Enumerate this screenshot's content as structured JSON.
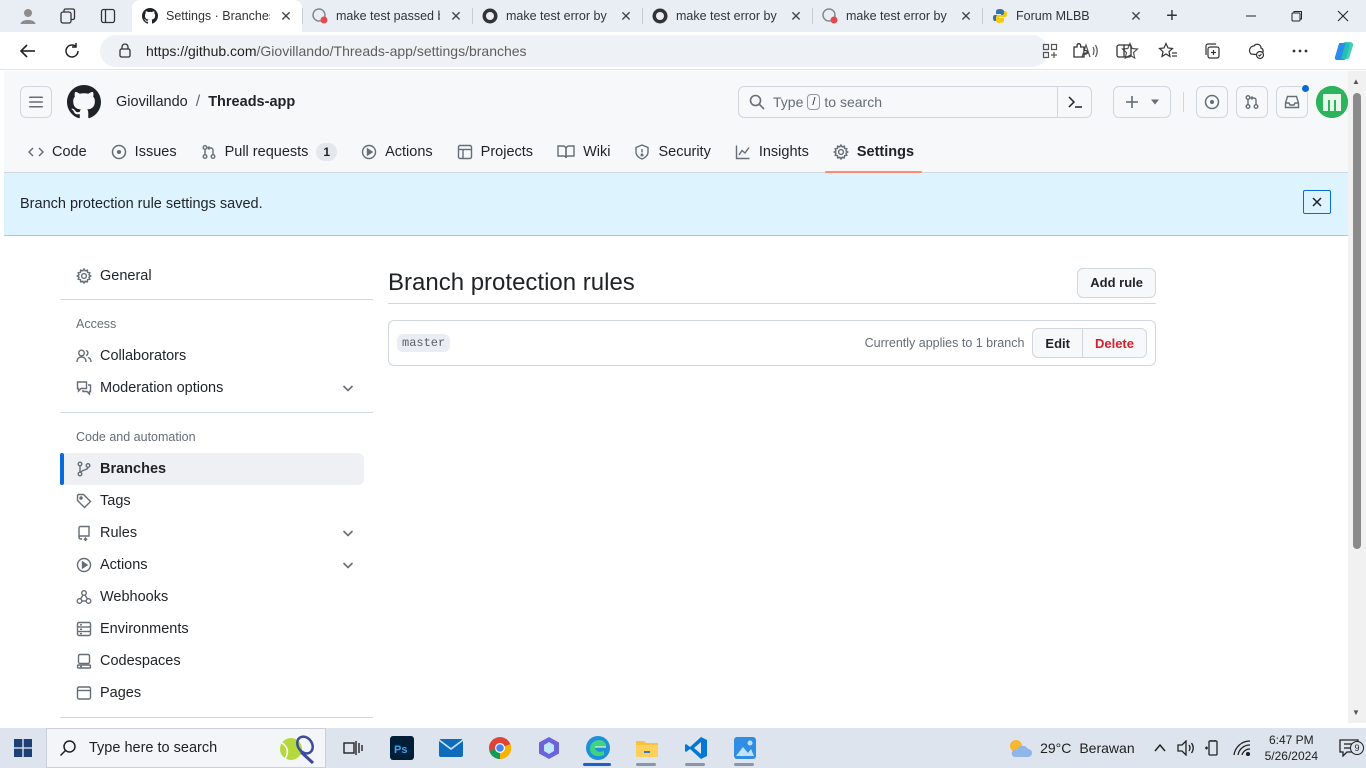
{
  "browser": {
    "tabs": [
      {
        "title": "Settings · Branches · Giovillando/Threads-app",
        "active": true
      },
      {
        "title": "make test passed by Giovillando",
        "active": false
      },
      {
        "title": "make test error by Giovillando",
        "active": false
      },
      {
        "title": "make test error by Giovillando",
        "active": false
      },
      {
        "title": "make test error by Giovillando",
        "active": false
      },
      {
        "title": "Forum MLBB",
        "active": false
      }
    ],
    "url_host": "https://github.com",
    "url_path": "/Giovillando/Threads-app/settings/branches"
  },
  "header": {
    "owner": "Giovillando",
    "separator": "/",
    "repo": "Threads-app",
    "search_prefix": "Type",
    "search_key": "/",
    "search_suffix": "to search"
  },
  "repo_nav": {
    "code": "Code",
    "issues": "Issues",
    "pulls": "Pull requests",
    "pulls_count": "1",
    "actions": "Actions",
    "projects": "Projects",
    "wiki": "Wiki",
    "security": "Security",
    "insights": "Insights",
    "settings": "Settings"
  },
  "flash": {
    "message": "Branch protection rule settings saved."
  },
  "sidebar": {
    "general": "General",
    "access_heading": "Access",
    "collaborators": "Collaborators",
    "moderation": "Moderation options",
    "code_heading": "Code and automation",
    "branches": "Branches",
    "tags": "Tags",
    "rules": "Rules",
    "actions": "Actions",
    "webhooks": "Webhooks",
    "environments": "Environments",
    "codespaces": "Codespaces",
    "pages": "Pages"
  },
  "main": {
    "title": "Branch protection rules",
    "add_rule": "Add rule",
    "rule": {
      "branch": "master",
      "applies": "Currently applies to 1 branch",
      "edit": "Edit",
      "delete": "Delete"
    }
  },
  "taskbar": {
    "search_placeholder": "Type here to search",
    "weather_temp": "29°C",
    "weather_desc": "Berawan",
    "time": "6:47 PM",
    "date": "5/26/2024",
    "notif_count": "9"
  },
  "colors": {
    "accent": "#0969da",
    "danger": "#cf222e",
    "flash_bg": "#ddf4ff",
    "nav_underline": "#fd8c73"
  }
}
